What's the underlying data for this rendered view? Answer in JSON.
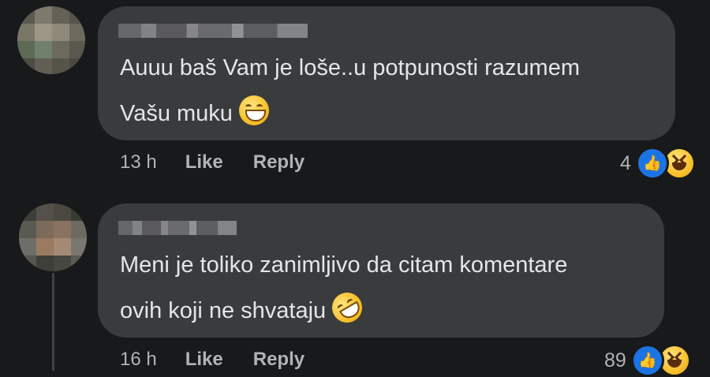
{
  "comments": [
    {
      "text_line1": "Auuu baš Vam je loše..u potpunosti razumem",
      "text_line2": "Vašu muku",
      "emoji": "grinning-face-emoji",
      "time": "13 h",
      "like_label": "Like",
      "reply_label": "Reply",
      "reaction_count": "4",
      "reactions": [
        "like-reaction-icon",
        "haha-reaction-icon"
      ]
    },
    {
      "text_line1": "Meni je toliko zanimljivo da citam komentare",
      "text_line2": "ovih koji ne shvataju",
      "emoji": "rolling-on-floor-laughing-emoji",
      "time": "16 h",
      "like_label": "Like",
      "reply_label": "Reply",
      "reaction_count": "89",
      "reactions": [
        "like-reaction-icon",
        "haha-reaction-icon"
      ]
    }
  ],
  "colors": {
    "background": "#18191a",
    "bubble": "#3a3b3c",
    "text": "#e4e6eb",
    "meta": "#b0b3b8",
    "like_blue": "#1b74e4"
  }
}
